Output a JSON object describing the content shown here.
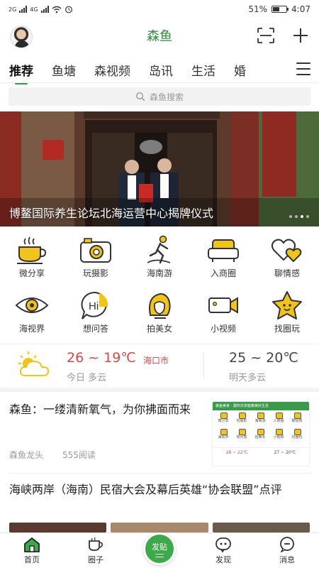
{
  "status_bar": {
    "network_left": "2G",
    "network_right": "4G",
    "battery": "51%",
    "battery_level": 0.51,
    "time": "4:07"
  },
  "header": {
    "title": "森鱼",
    "icons": [
      "avatar",
      "scan-icon",
      "plus-icon"
    ]
  },
  "tabs": [
    {
      "label": "推荐",
      "active": true
    },
    {
      "label": "鱼塘",
      "active": false
    },
    {
      "label": "森视频",
      "active": false
    },
    {
      "label": "岛讯",
      "active": false
    },
    {
      "label": "生活",
      "active": false
    },
    {
      "label": "婚",
      "active": false
    }
  ],
  "search": {
    "placeholder": "森鱼搜索"
  },
  "banner": {
    "caption": "博鳌国际养生论坛北海运营中心揭牌仪式"
  },
  "grid": {
    "row1": [
      {
        "label": "微分享",
        "icon": "coffee-cup-icon"
      },
      {
        "label": "玩摄影",
        "icon": "camera-icon"
      },
      {
        "label": "海南游",
        "icon": "traveler-icon"
      },
      {
        "label": "入商圈",
        "icon": "sofa-icon"
      },
      {
        "label": "聊情感",
        "icon": "hearts-icon"
      }
    ],
    "row2": [
      {
        "label": "海视界",
        "icon": "eye-icon"
      },
      {
        "label": "想问答",
        "icon": "hi-bubble-icon"
      },
      {
        "label": "拍美女",
        "icon": "woman-icon"
      },
      {
        "label": "小视频",
        "icon": "video-camera-icon"
      },
      {
        "label": "找圈玩",
        "icon": "star-face-icon"
      }
    ]
  },
  "weather": {
    "today_temp": "26 ~ 19℃",
    "city": "海口市",
    "today_desc": "今日 多云",
    "tomorrow_temp": "25 ~ 20℃",
    "tomorrow_desc": "明天多云",
    "icon": "partly-cloudy-icon"
  },
  "news": [
    {
      "title": "森鱼：一缕清新氧气，为你拂面而来",
      "source": "森鱼龙头",
      "reads": "555阅读",
      "thumb": {
        "banner_text": "森鱼美食 · 邀你共享健康美好生活",
        "labels": [
          "微分享",
          "玩摄影",
          "海南游",
          "入商圈",
          "聊情感",
          "海视界",
          "想问答",
          "拍美女",
          "小视频",
          "找圈玩"
        ],
        "today": "28 ~ 22℃",
        "tomorrow": "27 ~ 20℃"
      }
    },
    {
      "title": "海峡两岸（海南）民宿大会及幕后英雄“协会联盟”点评"
    }
  ],
  "bottom_nav": [
    {
      "label": "首页",
      "icon": "home-icon"
    },
    {
      "label": "圈子",
      "icon": "cup-icon"
    },
    {
      "label": "发贴",
      "icon": "post-icon"
    },
    {
      "label": "发现",
      "icon": "discover-icon"
    },
    {
      "label": "消息",
      "icon": "message-icon"
    }
  ],
  "colors": {
    "accent": "#2e9b3f",
    "temp_red": "#d94848",
    "icon_yellow": "#f2c417"
  }
}
